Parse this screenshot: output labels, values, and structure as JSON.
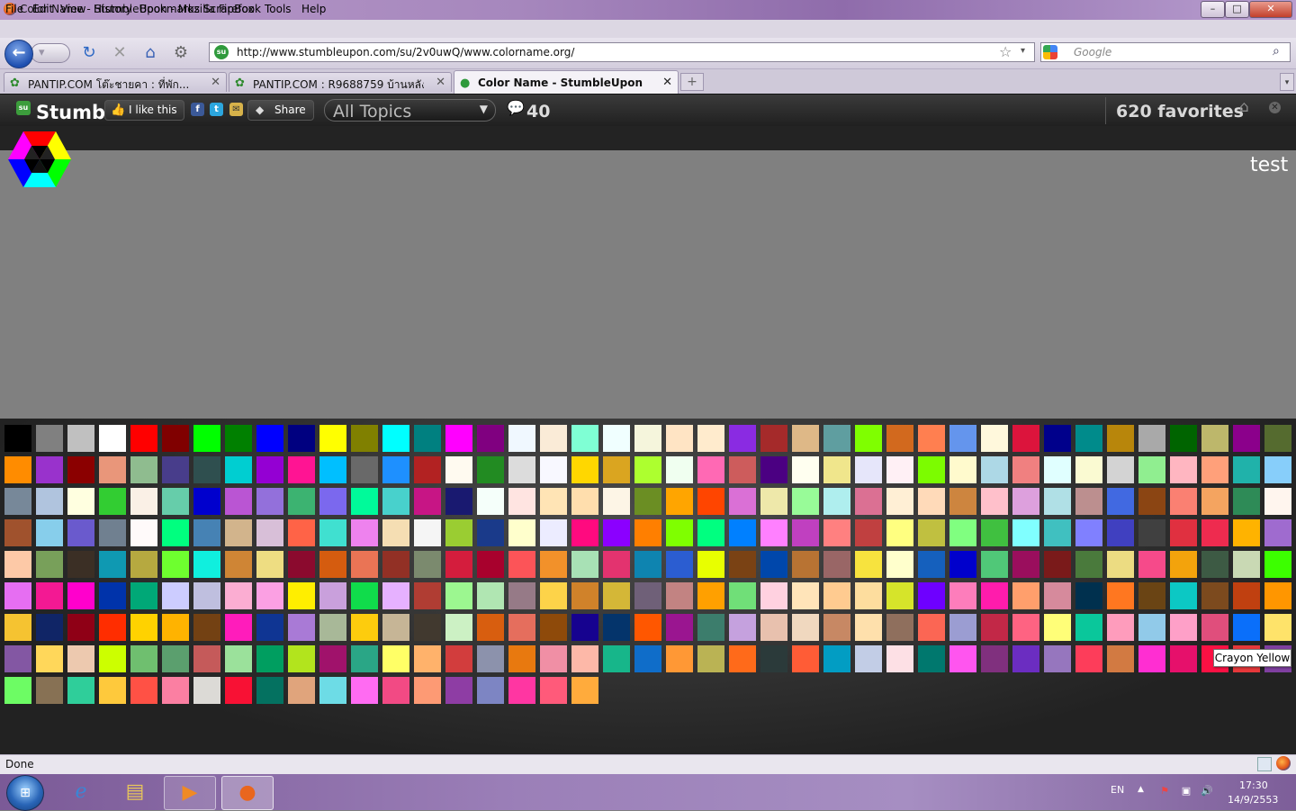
{
  "window": {
    "title": "Color Name - StumbleUpon - Mozilla Firefox",
    "min": "–",
    "max": "□",
    "close": "✕"
  },
  "menu": [
    "File",
    "Edit",
    "View",
    "History",
    "Bookmarks",
    "ScrapBook",
    "Tools",
    "Help"
  ],
  "nav": {
    "url": "http://www.stumbleupon.com/su/2v0uwQ/www.colorname.org/",
    "search_placeholder": "Google"
  },
  "tabs": [
    {
      "label": "PANTIP.COM โต๊ะชายคา : ที่พัก...",
      "active": false
    },
    {
      "label": "PANTIP.COM : R9688759 บ้านหลัง...",
      "active": false
    },
    {
      "label": "Color Name - StumbleUpon",
      "active": true
    }
  ],
  "stumble": {
    "logo": "Stumble",
    "like": "I like this",
    "share": "Share",
    "topics": "All Topics",
    "comments": "40",
    "favorites": "620 favorites"
  },
  "page": {
    "test": "test",
    "tooltip": "Crayon Yellow"
  },
  "colors": [
    "#000000",
    "#808080",
    "#c0c0c0",
    "#ffffff",
    "#ff0000",
    "#800000",
    "#00ff00",
    "#008000",
    "#0000ff",
    "#000080",
    "#ffff00",
    "#808000",
    "#00ffff",
    "#008080",
    "#ff00ff",
    "#800080",
    "#f0f8ff",
    "#faebd7",
    "#7fffd4",
    "#f0ffff",
    "#f5f5dc",
    "#ffe4c4",
    "#ffebcd",
    "#8a2be2",
    "#a52a2a",
    "#deb887",
    "#5f9ea0",
    "#7fff00",
    "#d2691e",
    "#ff7f50",
    "#6495ed",
    "#fff8dc",
    "#dc143c",
    "#00008b",
    "#008b8b",
    "#b8860b",
    "#a9a9a9",
    "#006400",
    "#bdb76b",
    "#8b008b",
    "#556b2f",
    "#ff8c00",
    "#9932cc",
    "#8b0000",
    "#e9967a",
    "#8fbc8f",
    "#483d8b",
    "#2f4f4f",
    "#00ced1",
    "#9400d3",
    "#ff1493",
    "#00bfff",
    "#696969",
    "#1e90ff",
    "#b22222",
    "#fffaf0",
    "#228b22",
    "#dcdcdc",
    "#f8f8ff",
    "#ffd700",
    "#daa520",
    "#adff2f",
    "#f0fff0",
    "#ff69b4",
    "#cd5c5c",
    "#4b0082",
    "#fffff0",
    "#f0e68c",
    "#e6e6fa",
    "#fff0f5",
    "#7cfc00",
    "#fffacd",
    "#add8e6",
    "#f08080",
    "#e0ffff",
    "#fafad2",
    "#d3d3d3",
    "#90ee90",
    "#ffb6c1",
    "#ffa07a",
    "#20b2aa",
    "#87cefa",
    "#778899",
    "#b0c4de",
    "#ffffe0",
    "#32cd32",
    "#faf0e6",
    "#66cdaa",
    "#0000cd",
    "#ba55d3",
    "#9370db",
    "#3cb371",
    "#7b68ee",
    "#00fa9a",
    "#48d1cc",
    "#c71585",
    "#191970",
    "#f5fffa",
    "#ffe4e1",
    "#ffe4b5",
    "#ffdead",
    "#fdf5e6",
    "#6b8e23",
    "#ffa500",
    "#ff4500",
    "#da70d6",
    "#eee8aa",
    "#98fb98",
    "#afeeee",
    "#db7093",
    "#ffefd5",
    "#ffdab9",
    "#cd853f",
    "#ffc0cb",
    "#dda0dd",
    "#b0e0e6",
    "#bc8f8f",
    "#4169e1",
    "#8b4513",
    "#fa8072",
    "#f4a460",
    "#2e8b57",
    "#fff5ee",
    "#a0522d",
    "#87ceeb",
    "#6a5acd",
    "#708090",
    "#fffafa",
    "#00ff7f",
    "#4682b4",
    "#d2b48c",
    "#d8bfd8",
    "#ff6347",
    "#40e0d0",
    "#ee82ee",
    "#f5deb3",
    "#f5f5f5",
    "#9acd32",
    "#1a3a8a",
    "#ffffcc",
    "#ececff",
    "#ff0a7f",
    "#8b00ff",
    "#ff7f00",
    "#7fff00",
    "#00ff80",
    "#0080ff",
    "#ff80ff",
    "#c040c0",
    "#ff8080",
    "#c04040",
    "#ffff80",
    "#c0c040",
    "#80ff80",
    "#40c040",
    "#80ffff",
    "#40c0c0",
    "#8080ff",
    "#4040c0",
    "#404040",
    "#e03040",
    "#ee2b4f",
    "#ffb300",
    "#9f6bcf",
    "#fdc9a7",
    "#78a05a",
    "#3b2f25",
    "#0f99b2",
    "#b6a940",
    "#6eff2f",
    "#10efde",
    "#cf8535",
    "#eedd82",
    "#8b0a2e",
    "#d55c0f",
    "#ea7455",
    "#923025",
    "#7b8a6e",
    "#d41d3d",
    "#a8012d",
    "#fc5458",
    "#f2912a",
    "#a8e1b5",
    "#e3336f",
    "#0e84b0",
    "#2b5dd1",
    "#e8ff00",
    "#7a4214",
    "#0047ab",
    "#b87333",
    "#996666",
    "#f7e33e",
    "#ffffcc",
    "#1560bd",
    "#0000cc",
    "#50c878",
    "#9a0e5d",
    "#7a1a1a",
    "#4a7a3c",
    "#ecdc82",
    "#f64a8a",
    "#f3a30c",
    "#3d5a44",
    "#c9d9b4",
    "#3cff00",
    "#e66ef2",
    "#f31993",
    "#ff00cc",
    "#0033aa",
    "#00a877",
    "#ccccff",
    "#bfbfdf",
    "#fbadd2",
    "#fba0e3",
    "#ffee00",
    "#c9a0dc",
    "#10dc4b",
    "#e6b1ff",
    "#b03d33",
    "#9cf790",
    "#b0e6b2",
    "#967a87",
    "#fdd349",
    "#d0822a",
    "#d4b737",
    "#6f6078",
    "#c28382",
    "#ffa000",
    "#70df78",
    "#ffd1e0",
    "#ffe4b9",
    "#ffcb90",
    "#fddd9e",
    "#d6e42a",
    "#6e00ff",
    "#fd7dbb",
    "#ff1cac",
    "#ff9f6c",
    "#d68a9c",
    "#00304e",
    "#ff7720",
    "#6a4414",
    "#0cc8c4",
    "#7c4a1e",
    "#c04010",
    "#ff9600",
    "#f5c331",
    "#102566",
    "#8f0016",
    "#ff2d00",
    "#ffd200",
    "#ffb300",
    "#734113",
    "#ff1cbb",
    "#0f3593",
    "#a97ad6",
    "#a8b898",
    "#fdcc0d",
    "#c6b596",
    "#41392f",
    "#ccf1c4",
    "#d85e0f",
    "#e56e5d",
    "#8e4a0a",
    "#16028f",
    "#04346b",
    "#ff5700",
    "#9a1590",
    "#3c7d6c",
    "#c5a1de",
    "#e8c1ae",
    "#f0d8bf",
    "#c78864",
    "#fee0ac",
    "#8f6f5d",
    "#fb6654",
    "#9b9dd2",
    "#c22847",
    "#fe6382",
    "#fffe78",
    "#0ac79b",
    "#fe9cbc",
    "#91cae9",
    "#fea0c8",
    "#e04e7c",
    "#0a6ffa",
    "#fee36a",
    "#8357a3",
    "#ffd75a",
    "#edc9af",
    "#ccff00",
    "#6fbf6f",
    "#5b9f6e",
    "#c55a5a",
    "#9be19b",
    "#009e60",
    "#b2e41d",
    "#a0126b",
    "#2aa686",
    "#ffff66",
    "#ffb26b",
    "#d23d3d",
    "#8c92ac",
    "#e8790f",
    "#f08fa5",
    "#fdb8a8",
    "#17b68a",
    "#0f6dc9",
    "#ff9835",
    "#bab354",
    "#ff6a1a",
    "#2b3a3a",
    "#ff5c36",
    "#029dc3",
    "#c2cde6",
    "#fde0e5",
    "#00786e",
    "#ff55ef",
    "#80307e",
    "#6b2dc1",
    "#9676be",
    "#fd3d5a",
    "#d27a42",
    "#ff2ed2",
    "#e6106b",
    "#fb1143",
    "#e6383a",
    "#7f3fa0",
    "#6dfc64",
    "#877154",
    "#2fce9a",
    "#fec93c",
    "#ff5145",
    "#fb7fa2",
    "#dcdad6",
    "#f81134",
    "#047160",
    "#e0a47c",
    "#6ddce6",
    "#ff6bf2",
    "#f24a84",
    "#fd9a74",
    "#8e3da4",
    "#7d85c3",
    "#ff36a2",
    "#ff5a7a",
    "#ffab3c"
  ],
  "status": {
    "text": "Done"
  },
  "taskbar": {
    "lang": "EN",
    "time": "17:30",
    "date": "14/9/2553"
  }
}
